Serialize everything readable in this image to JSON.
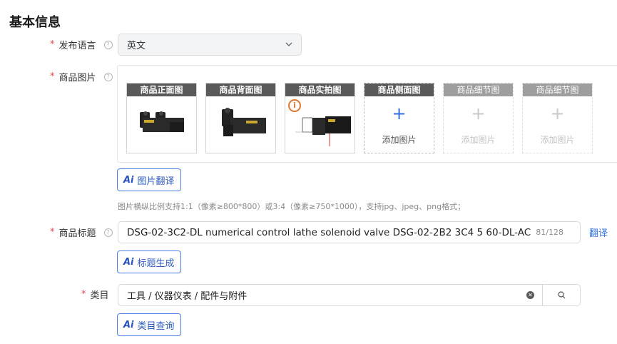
{
  "section": {
    "title": "基本信息"
  },
  "language": {
    "label": "发布语言",
    "required_mark": "*",
    "value": "英文",
    "help_icon": "question-circle-icon",
    "chevron_icon": "chevron-down-icon"
  },
  "images": {
    "label": "商品图片",
    "required_mark": "*",
    "help_icon": "question-circle-icon",
    "cards": [
      {
        "title": "商品正面图",
        "state": "filled"
      },
      {
        "title": "商品背面图",
        "state": "filled"
      },
      {
        "title": "商品实拍图",
        "state": "filled",
        "badge_icon": "info-icon"
      },
      {
        "title": "商品侧面图",
        "state": "empty",
        "add_text": "添加图片",
        "plus_icon": "plus-icon"
      },
      {
        "title": "商品细节图",
        "state": "disabled",
        "add_text": "添加图片",
        "plus_icon": "plus-icon"
      },
      {
        "title": "商品细节图",
        "state": "disabled",
        "add_text": "添加图片",
        "plus_icon": "plus-icon"
      }
    ],
    "translate_button": "图片翻译",
    "hint": "图片横纵比例支持1:1（像素≥800*800）或3:4（像素≥750*1000），支持jpg、jpeg、png格式；"
  },
  "product_title": {
    "label": "商品标题",
    "required_mark": "*",
    "help_icon": "question-circle-icon",
    "value": "DSG-02-3C2-DL numerical control lathe solenoid valve DSG-02-2B2 3C4 5 60-DL-AC",
    "counter": "81/128",
    "translate_link": "翻译",
    "generate_button": "标题生成"
  },
  "category": {
    "label": "类目",
    "required_mark": "*",
    "value": "工具 / 仪器仪表 / 配件与附件",
    "clear_icon": "clear-icon",
    "search_icon": "search-icon",
    "query_button": "类目查询"
  },
  "ai_icon_text": "Ai",
  "colors": {
    "accent": "#2d6fe0",
    "required": "#e5484d",
    "card_header": "#5a5a5a",
    "card_header_disabled": "#9e9e9e"
  }
}
